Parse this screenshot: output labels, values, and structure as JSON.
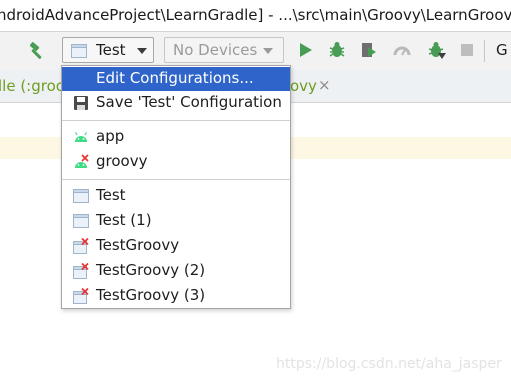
{
  "window": {
    "title": "ndroidAdvanceProject\\LearnGradle] - ...\\src\\main\\Groovy\\LearnGroovy"
  },
  "toolbar": {
    "run_config": "Test",
    "device": "No Devices",
    "trailing": "G"
  },
  "tabs": {
    "partial_left": "lle (:groo",
    "partial_right": "ovy",
    "close_glyph": "×"
  },
  "menu": {
    "actions": [
      {
        "label": "Edit Configurations...",
        "icon": "none",
        "selected": true
      },
      {
        "label": "Save 'Test' Configuration",
        "icon": "floppy-disk-icon",
        "selected": false
      }
    ],
    "modules": [
      {
        "label": "app",
        "icon": "android-icon",
        "error": false
      },
      {
        "label": "groovy",
        "icon": "android-icon",
        "error": true
      }
    ],
    "configs": [
      {
        "label": "Test",
        "icon": "config-icon",
        "error": false
      },
      {
        "label": "Test (1)",
        "icon": "config-icon",
        "error": false
      },
      {
        "label": "TestGroovy",
        "icon": "config-icon",
        "error": true
      },
      {
        "label": "TestGroovy (2)",
        "icon": "config-icon",
        "error": true
      },
      {
        "label": "TestGroovy (3)",
        "icon": "config-icon",
        "error": true
      }
    ]
  },
  "watermark": "https://blog.csdn.net/aha_jasper",
  "colors": {
    "selection": "#2f65ca",
    "android_green": "#3ddc84",
    "error_red": "#e53935",
    "run_green": "#499c54"
  }
}
